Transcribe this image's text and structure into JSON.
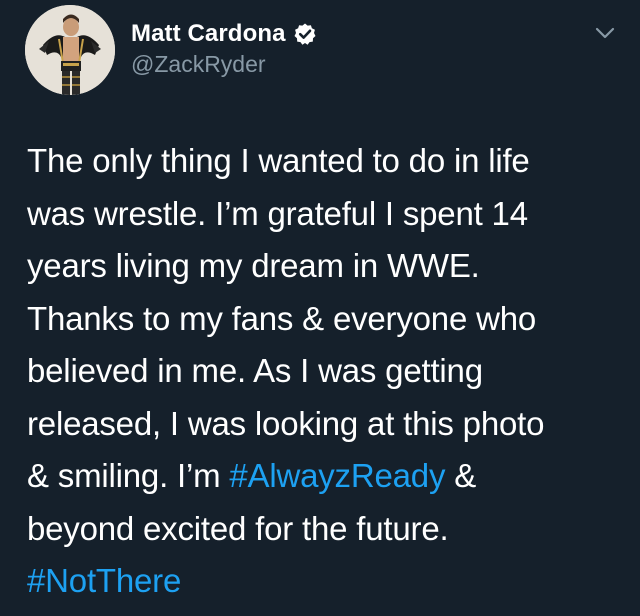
{
  "author": {
    "display_name": "Matt Cardona",
    "handle": "@ZackRyder",
    "verified": true,
    "avatar_icon": "profile-photo"
  },
  "tweet": {
    "lines": [
      "The only thing I wanted to do in life",
      "was wrestle. I’m grateful I spent 14",
      "years living my dream in WWE.",
      "Thanks to my fans & everyone who",
      "believed in me. As I was getting",
      "released, I was looking at this photo",
      "& smiling. I’m",
      "&",
      "beyond excited for the future."
    ],
    "hashtag_1": "#AlwayzReady",
    "hashtag_2": "#NotThere"
  },
  "colors": {
    "background": "#15202b",
    "primary_text": "#ffffff",
    "secondary_text": "#8899a6",
    "accent": "#1da1f2"
  },
  "icons": {
    "verified": "verified-badge-icon",
    "menu": "chevron-down-icon"
  }
}
